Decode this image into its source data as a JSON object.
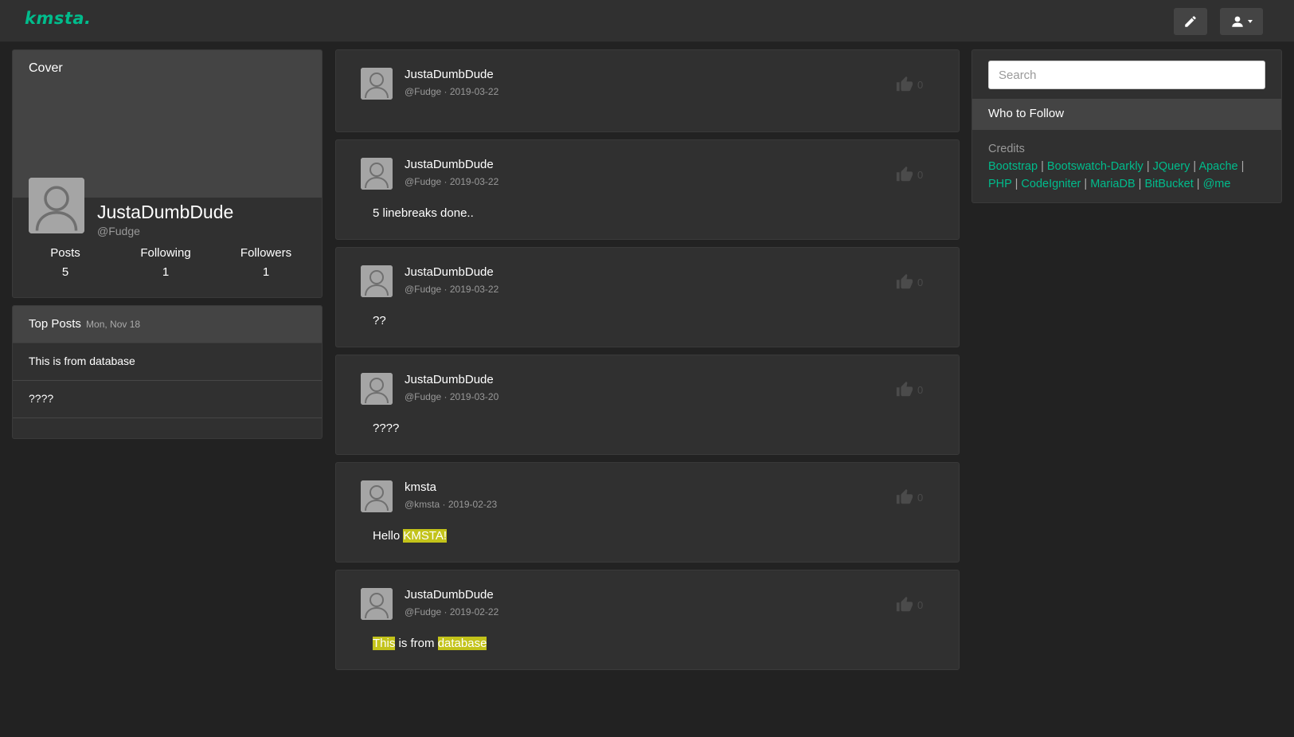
{
  "navbar": {
    "brand": "kmsta.",
    "icons": {
      "edit": "pencil-icon",
      "user": "user-icon",
      "caret": "caret-down-icon"
    }
  },
  "profile": {
    "cover_label": "Cover",
    "name": "JustaDumbDude",
    "handle": "@Fudge",
    "stats": [
      {
        "label": "Posts",
        "value": "5"
      },
      {
        "label": "Following",
        "value": "1"
      },
      {
        "label": "Followers",
        "value": "1"
      }
    ]
  },
  "top_posts": {
    "title": "Top Posts",
    "date": "Mon, Nov 18",
    "items": [
      "This is from database",
      "????"
    ]
  },
  "posts": [
    {
      "name": "JustaDumbDude",
      "meta": "@Fudge · 2019-03-22",
      "likes": "0",
      "body": ""
    },
    {
      "name": "JustaDumbDude",
      "meta": "@Fudge · 2019-03-22",
      "likes": "0",
      "body": "5 linebreaks done.."
    },
    {
      "name": "JustaDumbDude",
      "meta": "@Fudge · 2019-03-22",
      "likes": "0",
      "body": "??"
    },
    {
      "name": "JustaDumbDude",
      "meta": "@Fudge · 2019-03-20",
      "likes": "0",
      "body": "????"
    },
    {
      "name": "kmsta",
      "meta": "@kmsta · 2019-02-23",
      "likes": "0",
      "body_prefix": "Hello ",
      "body_highlight": "KMSTA!"
    },
    {
      "name": "JustaDumbDude",
      "meta": "@Fudge · 2019-02-22",
      "likes": "0",
      "body_hl1": "This",
      "body_mid": " is from ",
      "body_hl2": "database"
    }
  ],
  "sidebar": {
    "search_placeholder": "Search",
    "who_to_follow": "Who to Follow",
    "credits_title": "Credits",
    "credits": [
      "Bootstrap",
      "Bootswatch-Darkly",
      "JQuery",
      "Apache",
      "PHP",
      "CodeIgniter",
      "MariaDB",
      "BitBucket",
      "@me"
    ]
  },
  "colors": {
    "accent": "#00bc8c",
    "background": "#222222",
    "panel": "#303030",
    "highlight": "#c3c31a"
  }
}
